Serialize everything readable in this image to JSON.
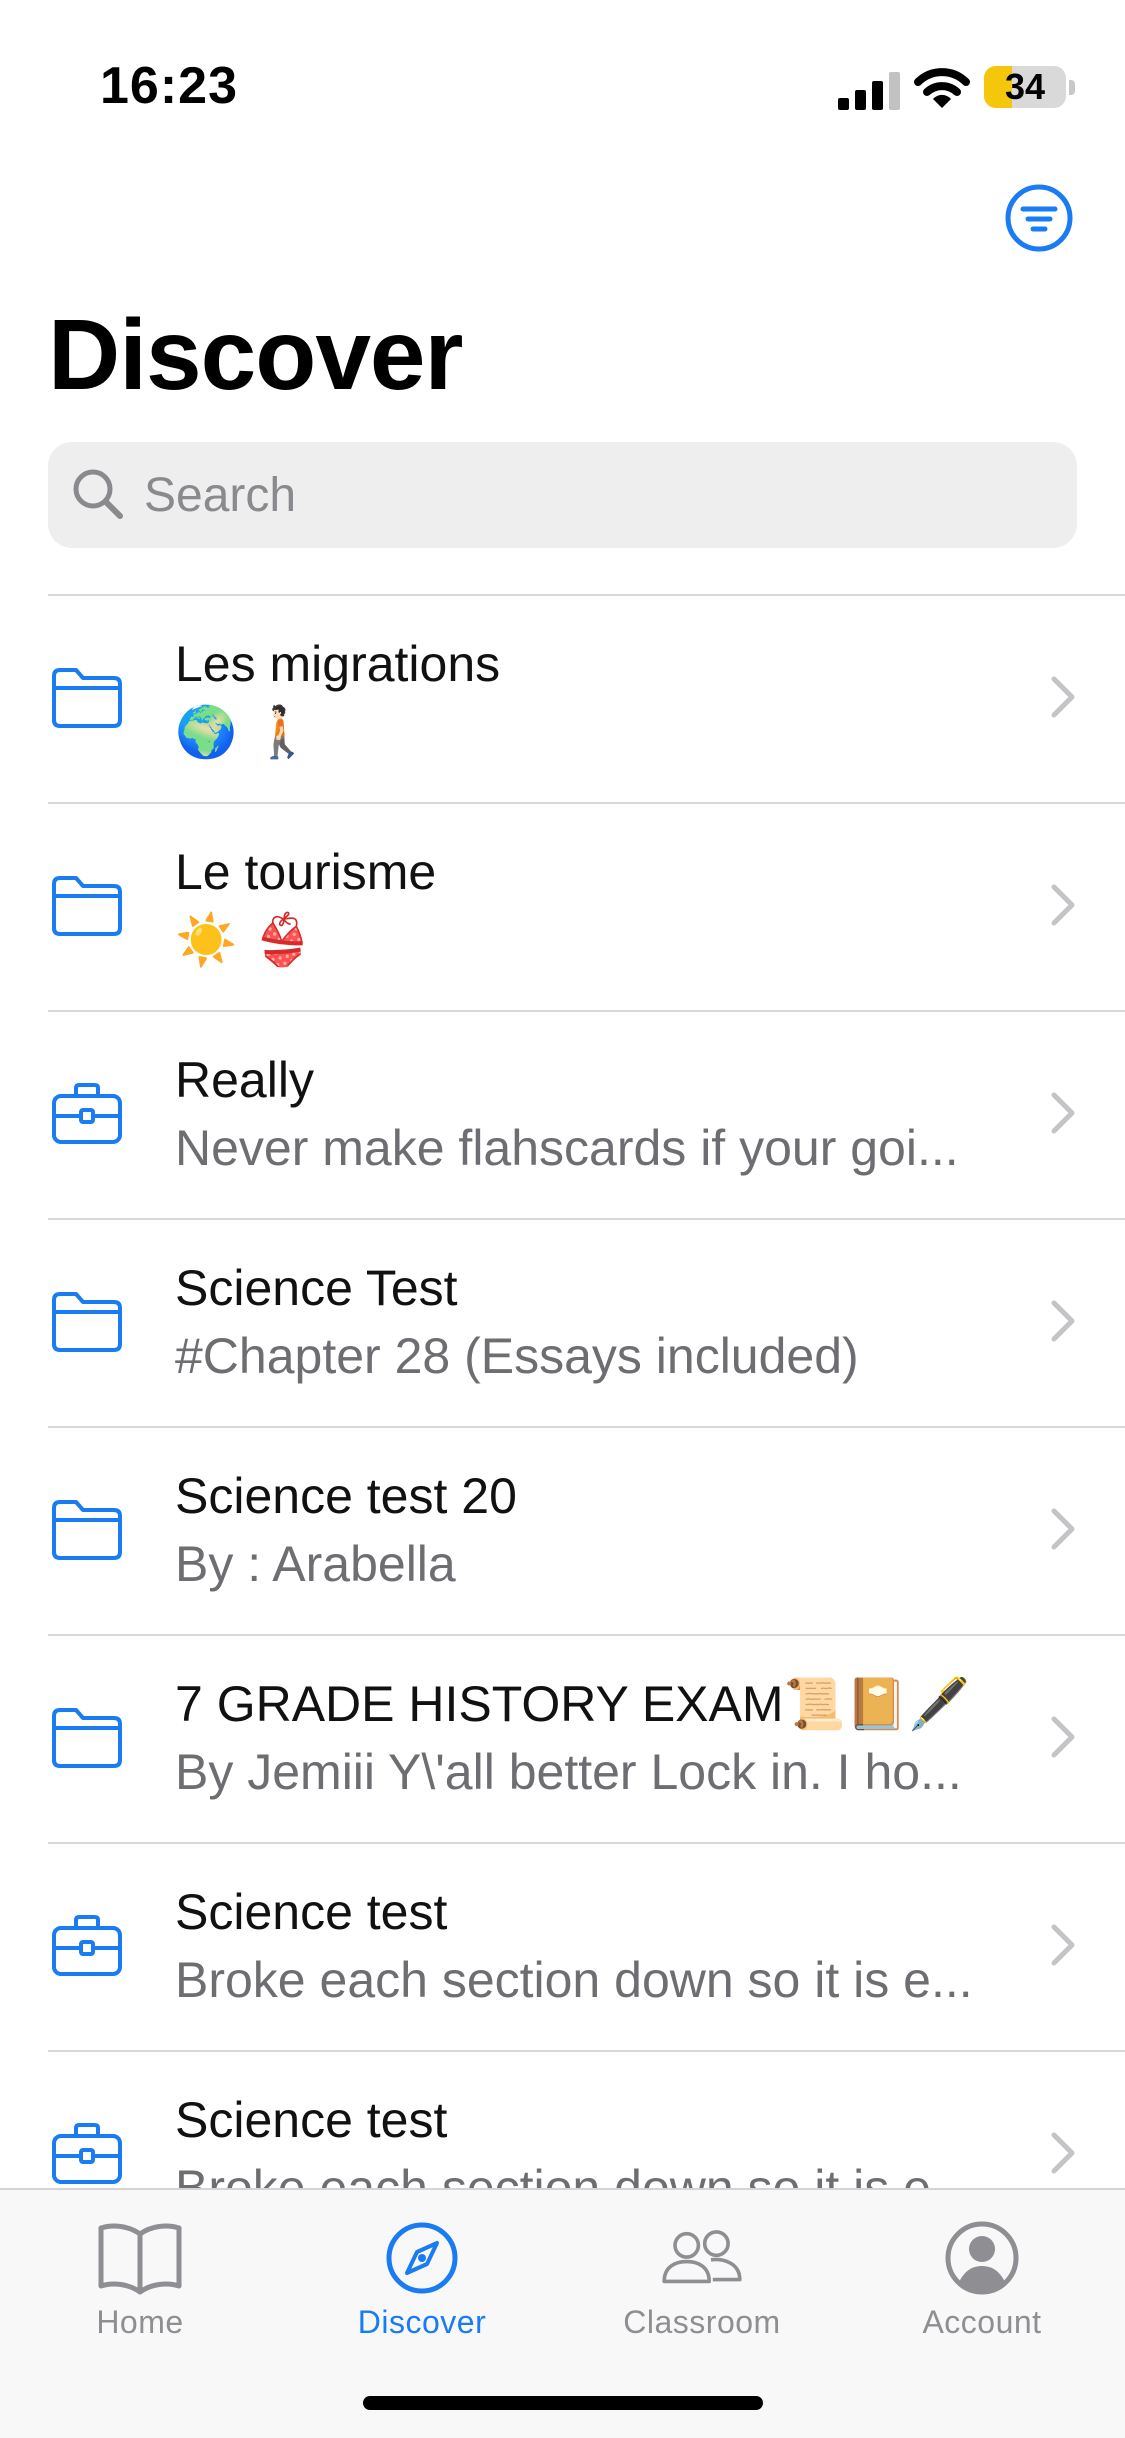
{
  "status_bar": {
    "time": "16:23",
    "battery_percent": "34",
    "battery_level": 0.34
  },
  "header": {
    "title": "Discover",
    "filter_icon": "filter-lines-icon"
  },
  "search": {
    "placeholder": "Search",
    "value": ""
  },
  "list": {
    "items": [
      {
        "icon": "folder-icon",
        "title": "Les migrations",
        "subtitle": "🌍 🚶🏻"
      },
      {
        "icon": "folder-icon",
        "title": "Le tourisme",
        "subtitle": "☀️ 👙"
      },
      {
        "icon": "briefcase-icon",
        "title": "Really",
        "subtitle": "Never make flahscards if your goi..."
      },
      {
        "icon": "folder-icon",
        "title": "Science Test",
        "subtitle": "#Chapter 28 (Essays included)"
      },
      {
        "icon": "folder-icon",
        "title": "Science test 20",
        "subtitle": "By : Arabella"
      },
      {
        "icon": "folder-icon",
        "title": "7 GRADE HISTORY EXAM📜📔🖋️",
        "subtitle": "By Jemiii Y\\'all better Lock in. I ho..."
      },
      {
        "icon": "briefcase-icon",
        "title": "Science test",
        "subtitle": "Broke each section down so it is e..."
      },
      {
        "icon": "briefcase-icon",
        "title": "Science test",
        "subtitle": "Broke each section down so it is e..."
      }
    ]
  },
  "tab_bar": {
    "tabs": [
      {
        "label": "Home",
        "icon": "book-icon",
        "active": false
      },
      {
        "label": "Discover",
        "icon": "compass-icon",
        "active": true
      },
      {
        "label": "Classroom",
        "icon": "people-icon",
        "active": false
      },
      {
        "label": "Account",
        "icon": "person-circle-icon",
        "active": false
      }
    ]
  },
  "colors": {
    "accent": "#1a7cf2",
    "inactive": "#8e8e93",
    "secondary_text": "#6d6d72"
  }
}
